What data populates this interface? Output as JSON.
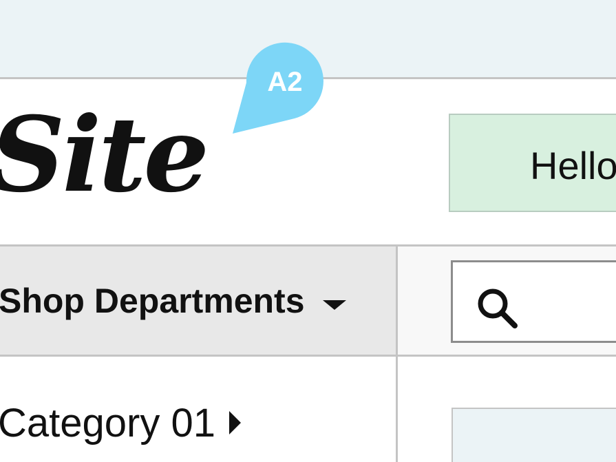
{
  "header": {
    "logo_text": "Site",
    "greeting": "Hello"
  },
  "annotation": {
    "label": "A2",
    "color": "#7dd6f7"
  },
  "nav": {
    "departments_label": "Shop Departments",
    "search": {
      "icon": "search-icon",
      "placeholder": "",
      "value": ""
    }
  },
  "categories": [
    {
      "label": "Category 01",
      "icon": "chevron-right-icon"
    }
  ],
  "colors": {
    "top_strip": "#ebf3f6",
    "greeting_bg": "#d8f0df",
    "departments_bg": "#e8e8e8",
    "divider": "#c4c4c4"
  }
}
